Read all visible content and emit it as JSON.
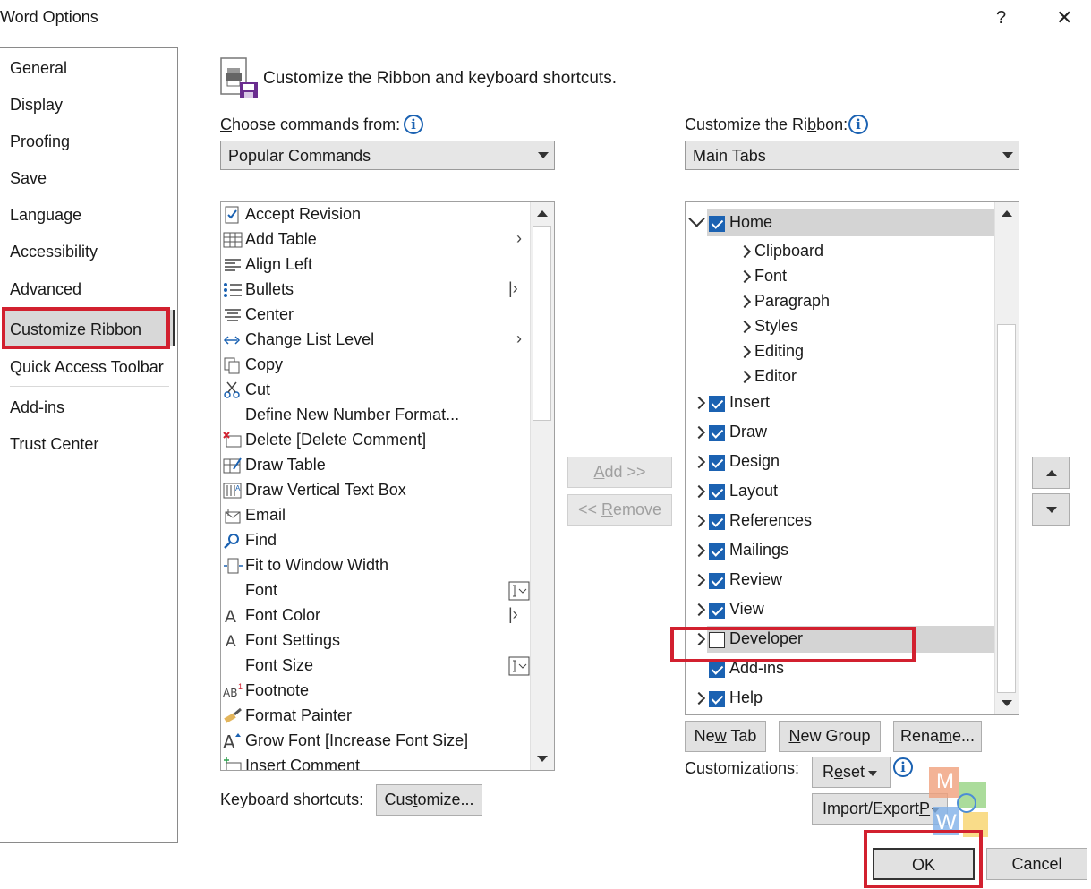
{
  "window": {
    "title": "Word Options",
    "help": "?",
    "close": "✕"
  },
  "sidebar": {
    "items": [
      {
        "label": "General"
      },
      {
        "label": "Display"
      },
      {
        "label": "Proofing"
      },
      {
        "label": "Save"
      },
      {
        "label": "Language"
      },
      {
        "label": "Accessibility"
      },
      {
        "label": "Advanced"
      },
      {
        "label": "Customize Ribbon",
        "selected": true
      },
      {
        "label": "Quick Access Toolbar"
      },
      {
        "label": "Add-ins"
      },
      {
        "label": "Trust Center"
      }
    ]
  },
  "header": {
    "title": "Customize the Ribbon and keyboard shortcuts."
  },
  "left": {
    "label": "Choose commands from:",
    "combo_value": "Popular Commands",
    "commands": [
      {
        "label": "Accept Revision",
        "icon": "accept-revision-icon",
        "sub": ""
      },
      {
        "label": "Add Table",
        "icon": "table-icon",
        "sub": "›"
      },
      {
        "label": "Align Left",
        "icon": "align-left-icon",
        "sub": ""
      },
      {
        "label": "Bullets",
        "icon": "bullets-icon",
        "sub": "|›"
      },
      {
        "label": "Center",
        "icon": "align-center-icon",
        "sub": ""
      },
      {
        "label": "Change List Level",
        "icon": "list-level-icon",
        "sub": "›"
      },
      {
        "label": "Copy",
        "icon": "copy-icon",
        "sub": ""
      },
      {
        "label": "Cut",
        "icon": "scissors-icon",
        "sub": ""
      },
      {
        "label": "Define New Number Format...",
        "icon": "",
        "sub": ""
      },
      {
        "label": "Delete [Delete Comment]",
        "icon": "delete-comment-icon",
        "sub": ""
      },
      {
        "label": "Draw Table",
        "icon": "draw-table-icon",
        "sub": ""
      },
      {
        "label": "Draw Vertical Text Box",
        "icon": "vertical-textbox-icon",
        "sub": ""
      },
      {
        "label": "Email",
        "icon": "email-icon",
        "sub": ""
      },
      {
        "label": "Find",
        "icon": "find-icon",
        "sub": ""
      },
      {
        "label": "Fit to Window Width",
        "icon": "fit-width-icon",
        "sub": ""
      },
      {
        "label": "Font",
        "icon": "",
        "sub": "box"
      },
      {
        "label": "Font Color",
        "icon": "font-color-icon",
        "sub": "|›"
      },
      {
        "label": "Font Settings",
        "icon": "font-settings-icon",
        "sub": ""
      },
      {
        "label": "Font Size",
        "icon": "",
        "sub": "box"
      },
      {
        "label": "Footnote",
        "icon": "footnote-icon",
        "sub": ""
      },
      {
        "label": "Format Painter",
        "icon": "format-painter-icon",
        "sub": ""
      },
      {
        "label": "Grow Font [Increase Font Size]",
        "icon": "grow-font-icon",
        "sub": ""
      },
      {
        "label": "Insert Comment",
        "icon": "insert-comment-icon",
        "sub": ""
      }
    ]
  },
  "middle": {
    "add": "Add >>",
    "remove": "<< Remove"
  },
  "right": {
    "label": "Customize the Ribbon:",
    "combo_value": "Main Tabs",
    "home": {
      "label": "Home",
      "checked": true
    },
    "groups": [
      "Clipboard",
      "Font",
      "Paragraph",
      "Styles",
      "Editing",
      "Editor"
    ],
    "tabs": [
      {
        "label": "Insert",
        "checked": true
      },
      {
        "label": "Draw",
        "checked": true
      },
      {
        "label": "Design",
        "checked": true
      },
      {
        "label": "Layout",
        "checked": true
      },
      {
        "label": "References",
        "checked": true
      },
      {
        "label": "Mailings",
        "checked": true
      },
      {
        "label": "Review",
        "checked": true
      },
      {
        "label": "View",
        "checked": true
      },
      {
        "label": "Developer",
        "checked": false
      },
      {
        "label": "Add-ins",
        "checked": true
      },
      {
        "label": "Help",
        "checked": true
      }
    ],
    "new_tab": "New Tab",
    "new_group": "New Group",
    "rename": "Rename...",
    "customizations_label": "Customizations:",
    "reset": "Reset",
    "import_export": "Import/Export"
  },
  "keyboard": {
    "label": "Keyboard shortcuts:",
    "button": "Customize..."
  },
  "footer": {
    "ok": "OK",
    "cancel": "Cancel"
  },
  "watermark": {
    "letters": [
      "M",
      "W"
    ]
  }
}
